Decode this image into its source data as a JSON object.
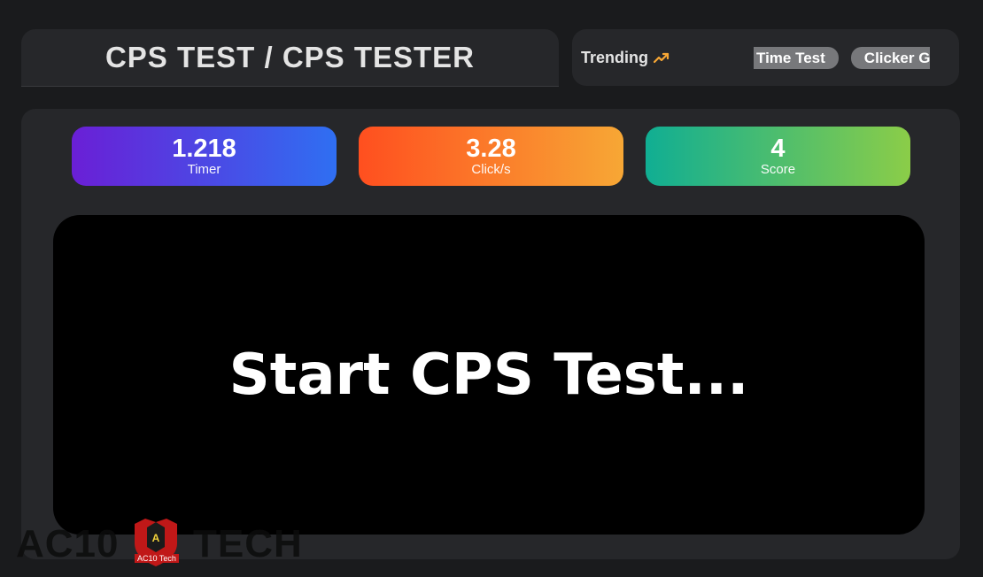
{
  "header": {
    "title": "CPS TEST / CPS TESTER"
  },
  "trending": {
    "label": "Trending",
    "icon": "trending-up-icon",
    "items": [
      "Time Test",
      "Clicker G"
    ]
  },
  "stats": {
    "timer": {
      "value": "1.218",
      "label": "Timer"
    },
    "clicks": {
      "value": "3.28",
      "label": "Click/s"
    },
    "score": {
      "value": "4",
      "label": "Score"
    }
  },
  "click_area": {
    "prompt": "Start CPS Test..."
  },
  "watermark": {
    "left": "AC10",
    "right": "TECH",
    "badge": "AC10 Tech",
    "emblem": "A"
  },
  "colors": {
    "background": "#1a1b1d",
    "card": "#26272a",
    "trend_accent": "#f7a735",
    "pill": "#77787b"
  }
}
